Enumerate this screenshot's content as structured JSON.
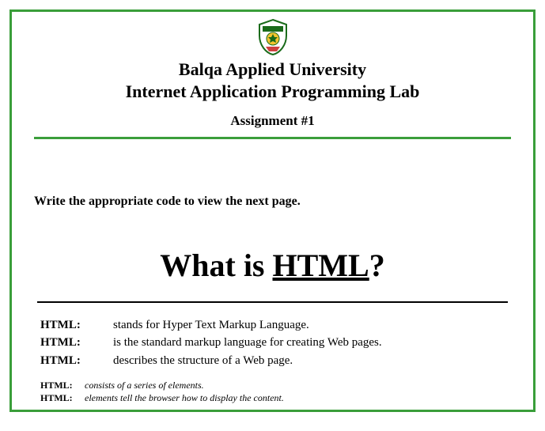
{
  "header": {
    "university": "Balqa Applied University",
    "course": "Internet Application Programming Lab",
    "assignment": "Assignment #1"
  },
  "instruction": "Write the appropriate code to view the next page.",
  "main_heading": {
    "prefix": "What is ",
    "underlined": "HTML",
    "suffix": "?"
  },
  "definitions": [
    {
      "label": "HTML:",
      "desc": "stands for Hyper Text Markup Language."
    },
    {
      "label": "HTML:",
      "desc": "is the standard markup language for creating Web pages."
    },
    {
      "label": "HTML:",
      "desc": "describes the structure of a Web page."
    }
  ],
  "small_definitions": [
    {
      "label": "HTML:",
      "desc": "consists of a series of elements."
    },
    {
      "label": "HTML:",
      "desc": "elements tell the browser how to display the content."
    }
  ]
}
